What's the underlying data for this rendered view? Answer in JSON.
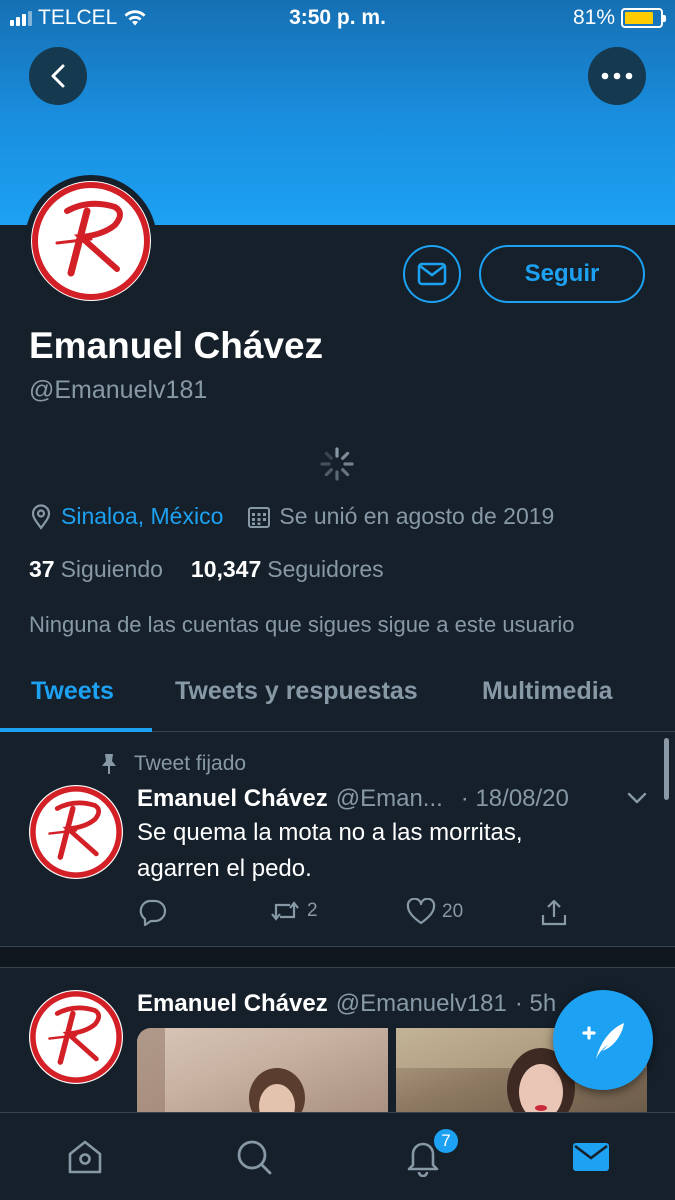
{
  "status_bar": {
    "carrier": "TELCEL",
    "time": "3:50 p. m.",
    "battery_percent": "81%",
    "battery_level": 0.81
  },
  "profile": {
    "name": "Emanuel Chávez",
    "handle": "@Emanuelv181",
    "location": "Sinaloa, México",
    "joined": "Se unió en agosto de 2019",
    "following_count": "37",
    "following_label": "Siguiendo",
    "followers_count": "10,347",
    "followers_label": "Seguidores",
    "mutual_note": "Ninguna de las cuentas que sigues sigue a este usuario",
    "follow_button": "Seguir"
  },
  "tabs": [
    {
      "label": "Tweets",
      "active": true
    },
    {
      "label": "Tweets y respuestas",
      "active": false
    },
    {
      "label": "Multimedia",
      "active": false
    }
  ],
  "tweets": [
    {
      "pinned_label": "Tweet fijado",
      "name": "Emanuel Chávez",
      "handle": "@Eman...",
      "date": "· 18/08/20",
      "text_line1": "Se quema la mota no a las morritas,",
      "text_line2": "agarren el pedo.",
      "retweets": "2",
      "likes": "20"
    },
    {
      "name": "Emanuel Chávez",
      "handle": "@Emanuelv181",
      "date": "· 5h"
    }
  ],
  "bottom_nav": {
    "notifications_badge": "7"
  },
  "colors": {
    "background": "#15202b",
    "accent": "#1da1f2",
    "secondary_text": "#8899a6",
    "divider": "#38444d",
    "avatar_red": "#d32027"
  }
}
